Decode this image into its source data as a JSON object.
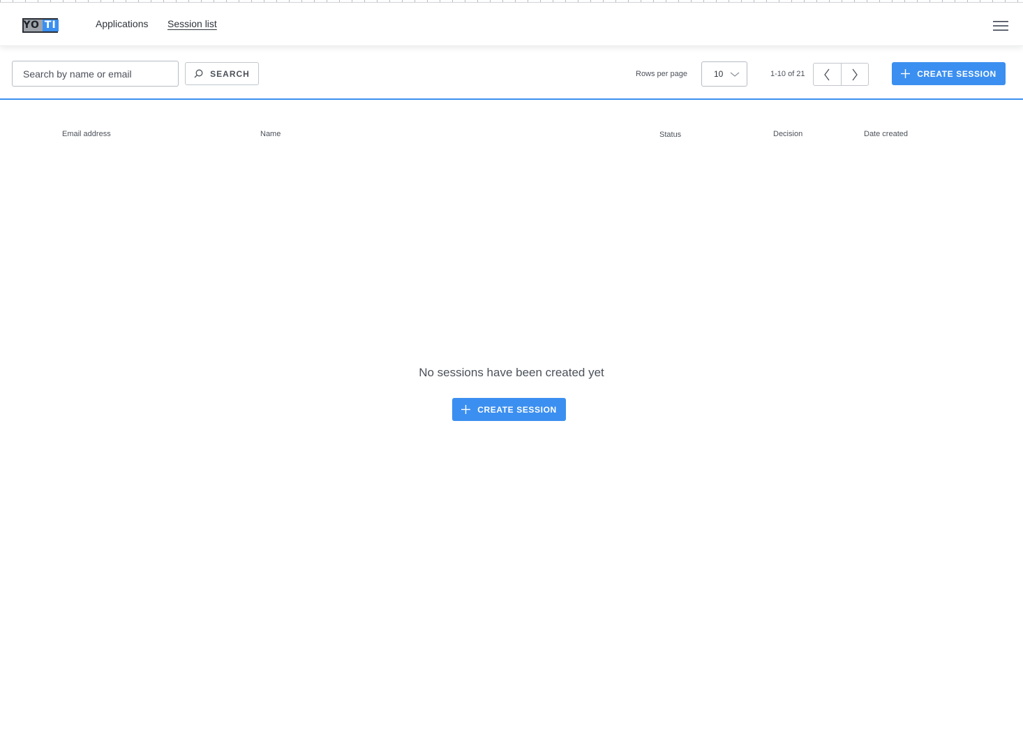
{
  "header": {
    "logo_text_left": "YO",
    "logo_text_right": "TI",
    "nav": {
      "applications": "Applications",
      "session_list": "Session list"
    },
    "menu_icon": "hamburger-menu-icon"
  },
  "toolbar": {
    "search_placeholder": "Search by name or email",
    "search_value": "",
    "search_button_label": "SEARCH",
    "search_icon": "search-icon",
    "rows_per_page_label": "Rows per page",
    "rows_per_page_value": "10",
    "pagination_range": "1-10 of 21",
    "prev_icon": "chevron-left-icon",
    "next_icon": "chevron-right-icon",
    "create_button_label": "CREATE SESSION"
  },
  "table": {
    "columns": [
      "Email address",
      "Name",
      "Status",
      "Decision",
      "Date created"
    ],
    "rows": []
  },
  "empty_state": {
    "message": "No sessions have been created yet",
    "create_button_label": "CREATE SESSION"
  },
  "colors": {
    "accent": "#3b8ff0",
    "text": "#3d4551",
    "border": "#b6bbc3"
  }
}
